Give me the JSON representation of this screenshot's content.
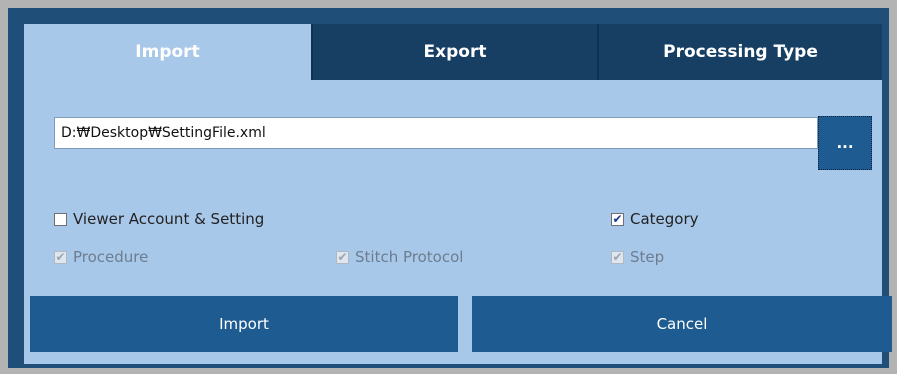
{
  "tabs": [
    {
      "label": "Import",
      "active": true
    },
    {
      "label": "Export",
      "active": false
    },
    {
      "label": "Processing Type",
      "active": false
    }
  ],
  "file_path": {
    "value": "D:₩Desktop₩SettingFile.xml",
    "browse_label": "..."
  },
  "options": {
    "viewer_account": {
      "label": "Viewer Account & Setting",
      "checked": false,
      "enabled": true
    },
    "category": {
      "label": "Category",
      "checked": true,
      "enabled": true
    },
    "procedure": {
      "label": "Procedure",
      "checked": true,
      "enabled": false
    },
    "stitch_protocol": {
      "label": "Stitch Protocol",
      "checked": true,
      "enabled": false
    },
    "step": {
      "label": "Step",
      "checked": true,
      "enabled": false
    }
  },
  "buttons": {
    "import_label": "Import",
    "cancel_label": "Cancel"
  },
  "colors": {
    "frame": "#1f4f78",
    "panel": "#a8c8ea",
    "tab_inactive": "#163f63",
    "button": "#1e5b90"
  },
  "check_glyph": "✔"
}
